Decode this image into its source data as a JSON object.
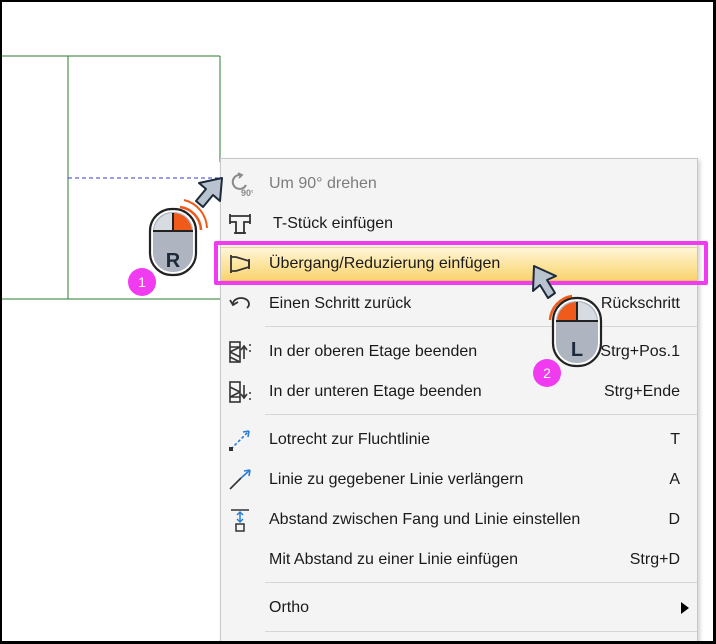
{
  "menu": {
    "items": [
      {
        "label": "Um 90° drehen",
        "shortcut": "",
        "icon": "rotate-90-icon",
        "disabled": true
      },
      {
        "label": "T-Stück einfügen",
        "shortcut": "",
        "icon": "t-piece-icon"
      },
      {
        "label": "Übergang/Reduzierung einfügen",
        "shortcut": "",
        "icon": "reducer-icon",
        "highlighted": true
      },
      {
        "label": "Einen Schritt zurück",
        "shortcut": "Rückschritt",
        "icon": "undo-icon"
      },
      {
        "label": "In der oberen Etage beenden",
        "shortcut": "Strg+Pos.1",
        "icon": "upper-floor-icon"
      },
      {
        "label": "In der unteren Etage beenden",
        "shortcut": "Strg+Ende",
        "icon": "lower-floor-icon"
      },
      {
        "label": "Lotrecht zur Fluchtlinie",
        "shortcut": "T",
        "icon": "perpendicular-icon"
      },
      {
        "label": "Linie zu gegebener Linie verlängern",
        "shortcut": "A",
        "icon": "extend-line-icon"
      },
      {
        "label": "Abstand zwischen Fang und Linie einstellen",
        "shortcut": "D",
        "icon": "distance-icon"
      },
      {
        "label": "Mit Abstand zu einer Linie einfügen",
        "shortcut": "Strg+D",
        "icon": ""
      },
      {
        "label": "Ortho",
        "shortcut": "",
        "icon": "",
        "submenu": true
      }
    ]
  },
  "annotations": {
    "right_mouse_label": "R",
    "left_mouse_label": "L",
    "step1": "1",
    "step2": "2",
    "highlight_color": "#f03bf0",
    "mouse_accent_color": "#f05a1a"
  }
}
